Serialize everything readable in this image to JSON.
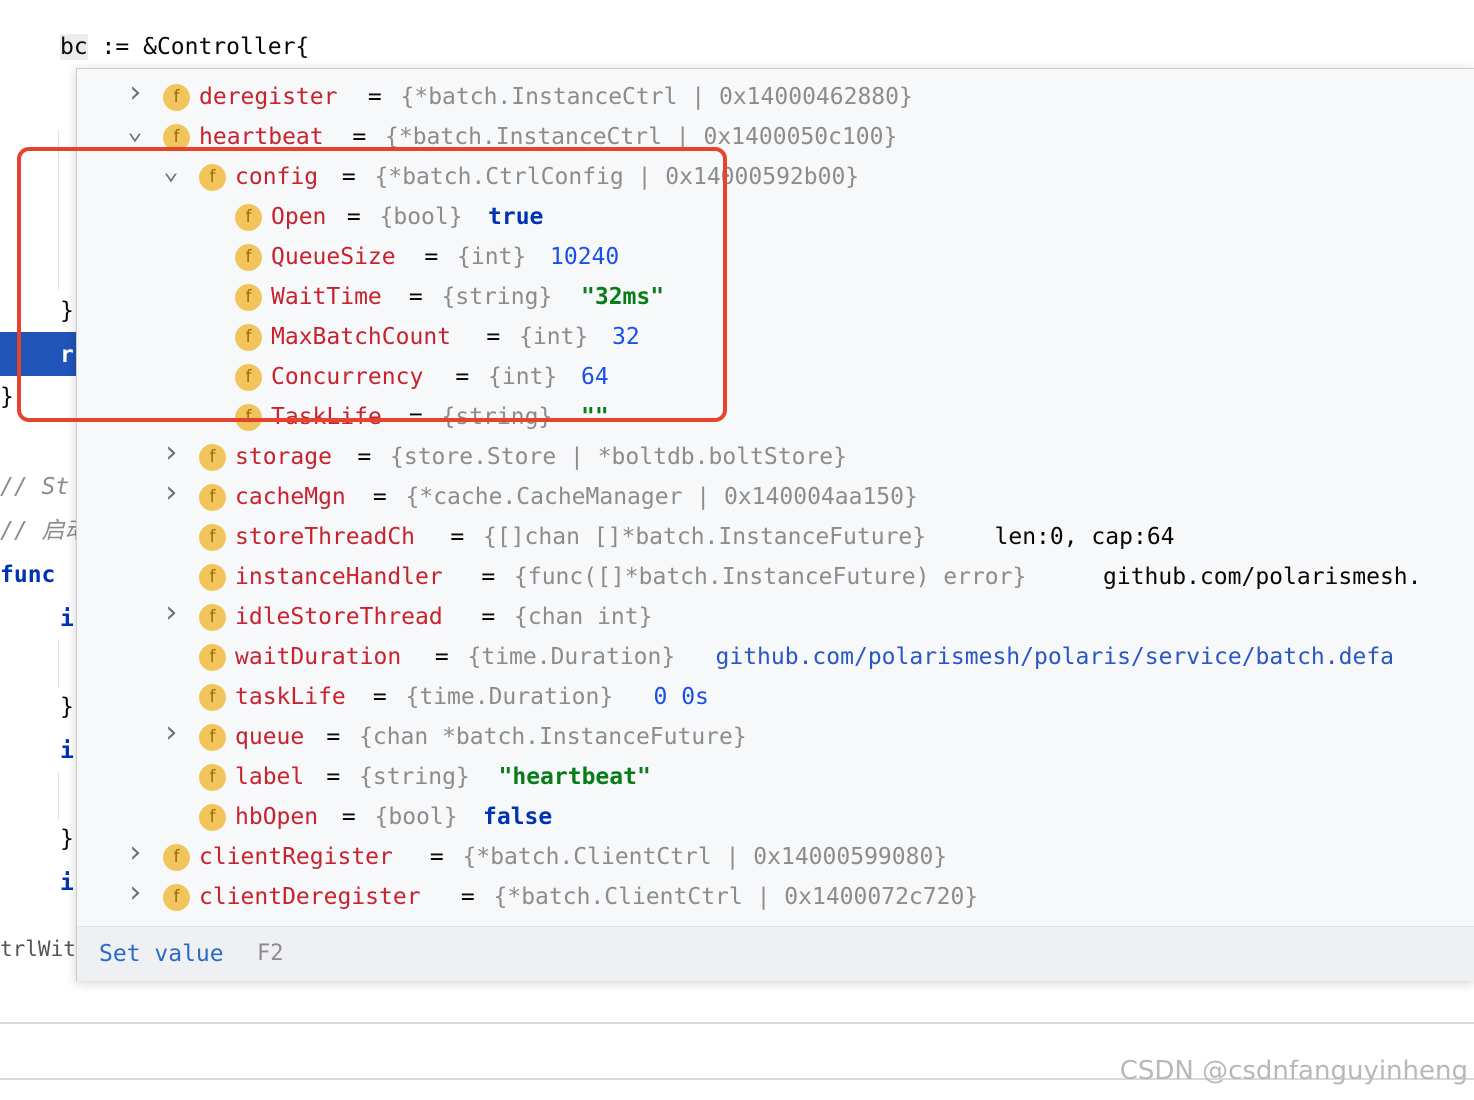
{
  "editor": {
    "line1_var": "bc",
    "line1_rest": " := &Controller{",
    "brace1": "}",
    "exec_text": "r",
    "brace_outer": "}",
    "comment1": "// St",
    "comment2": "// 启动",
    "func_kw": "func",
    "if1": "i",
    "brace2": "}",
    "if2": "i",
    "brace3": "}",
    "if3": "i",
    "ctrl_with": "trlWit"
  },
  "popup": {
    "rows": [
      {
        "name": "deregister",
        "eq": " = ",
        "type": "{*batch.InstanceCtrl | 0x14000462880}",
        "value": "",
        "expander": "collapsed"
      },
      {
        "name": "heartbeat",
        "eq": " = ",
        "type": "{*batch.InstanceCtrl | 0x1400050c100}",
        "value": "",
        "expander": "expanded"
      },
      {
        "name": "config",
        "eq": " = ",
        "type": "{*batch.CtrlConfig | 0x14000592b00}",
        "value": "",
        "expander": "expanded"
      },
      {
        "name": "Open",
        "eq": " = ",
        "type": "{bool}",
        "value": "true",
        "expander": "none"
      },
      {
        "name": "QueueSize",
        "eq": " = ",
        "type": "{int}",
        "value": "10240",
        "expander": "none"
      },
      {
        "name": "WaitTime",
        "eq": " = ",
        "type": "{string}",
        "value": "\"32ms\"",
        "expander": "none"
      },
      {
        "name": "MaxBatchCount",
        "eq": " = ",
        "type": "{int}",
        "value": "32",
        "expander": "none"
      },
      {
        "name": "Concurrency",
        "eq": " = ",
        "type": "{int}",
        "value": "64",
        "expander": "none"
      },
      {
        "name": "TaskLife",
        "eq": " = ",
        "type": "{string}",
        "value": "\"\"",
        "expander": "none"
      },
      {
        "name": "storage",
        "eq": " = ",
        "type": "{store.Store | *boltdb.boltStore}",
        "value": "",
        "expander": "collapsed"
      },
      {
        "name": "cacheMgn",
        "eq": " = ",
        "type": "{*cache.CacheManager | 0x140004aa150}",
        "value": "",
        "expander": "collapsed"
      },
      {
        "name": "storeThreadCh",
        "eq": " = ",
        "type": "{[]chan []*batch.InstanceFuture}",
        "value": "len:0, cap:64",
        "expander": "none"
      },
      {
        "name": "instanceHandler",
        "eq": " = ",
        "type": "{func([]*batch.InstanceFuture) error}",
        "value": "github.com/polarismesh.",
        "expander": "none"
      },
      {
        "name": "idleStoreThread",
        "eq": " = ",
        "type": "{chan int}",
        "value": "",
        "expander": "collapsed"
      },
      {
        "name": "waitDuration",
        "eq": " = ",
        "type": "{time.Duration}",
        "value": "github.com/polarismesh/polaris/service/batch.defa",
        "expander": "none"
      },
      {
        "name": "taskLife",
        "eq": " = ",
        "type": "{time.Duration}",
        "value": "0 0s",
        "expander": "none"
      },
      {
        "name": "queue",
        "eq": " = ",
        "type": "{chan *batch.InstanceFuture}",
        "value": "",
        "expander": "collapsed"
      },
      {
        "name": "label",
        "eq": " = ",
        "type": "{string}",
        "value": "\"heartbeat\"",
        "expander": "none"
      },
      {
        "name": "hbOpen",
        "eq": " = ",
        "type": "{bool}",
        "value": "false",
        "expander": "none"
      },
      {
        "name": "clientRegister",
        "eq": " = ",
        "type": "{*batch.ClientCtrl | 0x14000599080}",
        "value": "",
        "expander": "collapsed"
      },
      {
        "name": "clientDeregister",
        "eq": " = ",
        "type": "{*batch.ClientCtrl | 0x1400072c720}",
        "value": "",
        "expander": "collapsed"
      }
    ],
    "footer": {
      "set_value_label": "Set value",
      "set_value_key": "F2"
    },
    "field_icon_glyph": "f"
  },
  "watermark": "CSDN @csdnfanguyinheng",
  "colors": {
    "highlight_box": "#e5432d",
    "exec_line": "#2154b8",
    "field_icon": "#f2c55c"
  }
}
